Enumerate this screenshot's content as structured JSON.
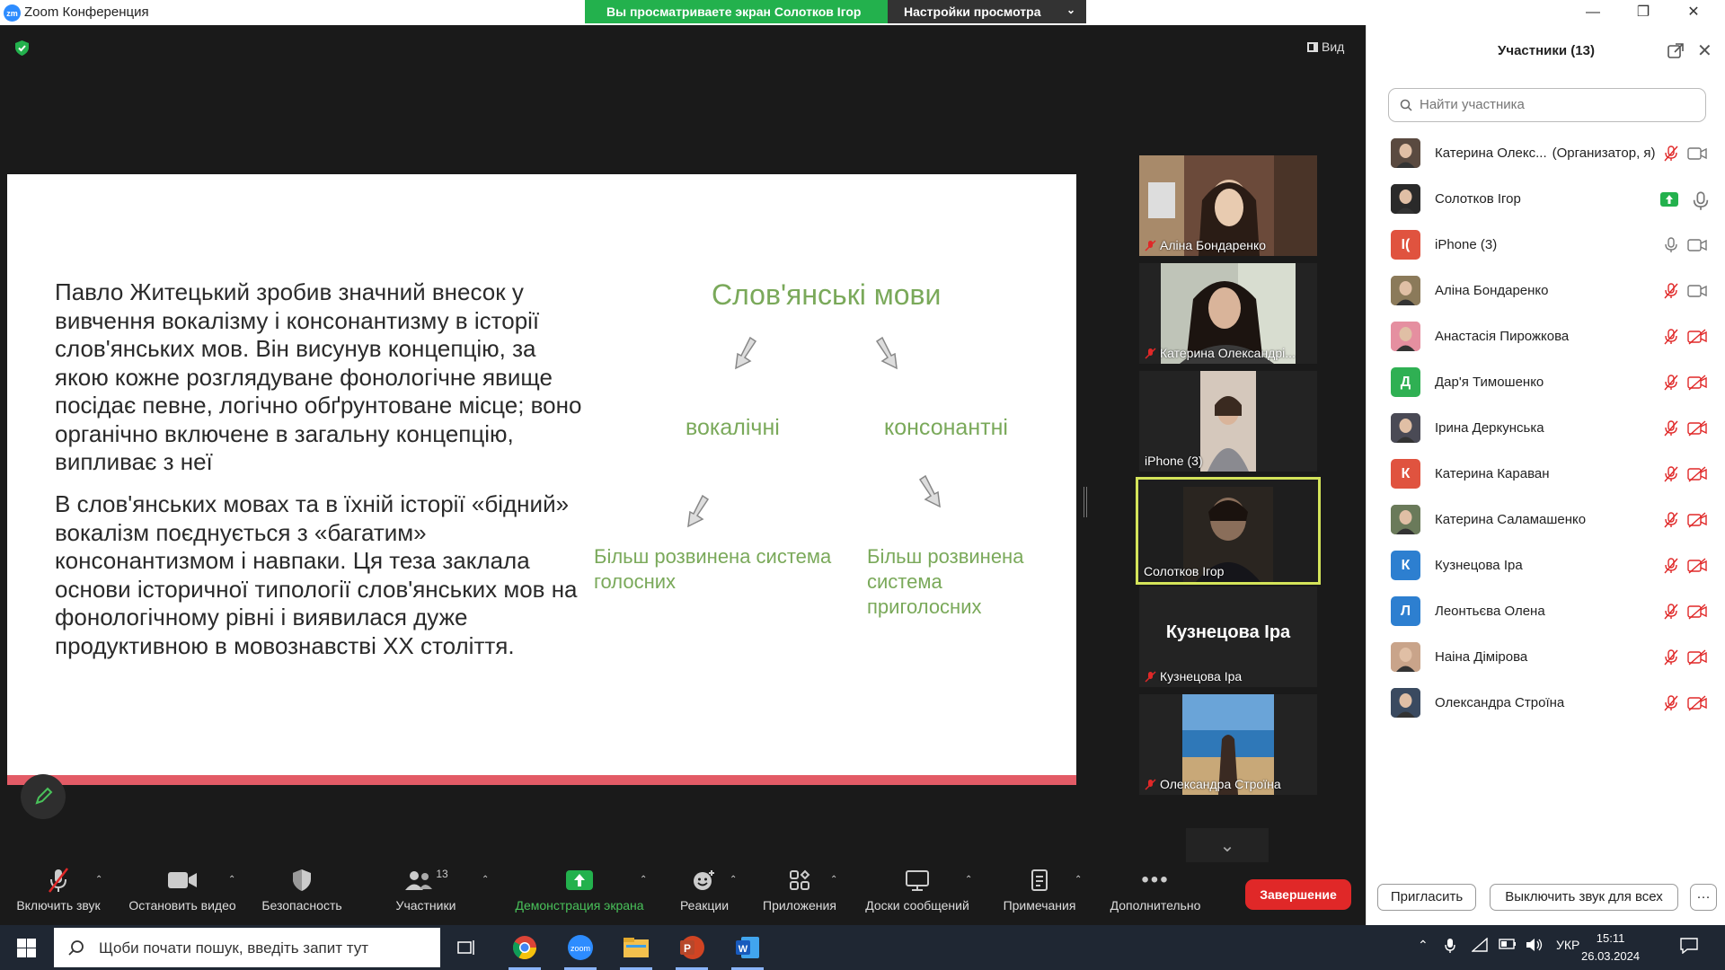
{
  "window": {
    "title": "Zoom Конференция",
    "app_icon_text": "zm",
    "share_banner": "Вы просматриваете экран Солотков Ігор",
    "view_settings": "Настройки просмотра"
  },
  "view_button": "Вид",
  "slide": {
    "paragraph1": "Павло Житецький зробив значний внесок у вивчення вокалізму і консонантизму в історії слов'янських мов. Він висунув концепцію, за якою кожне розглядуване фонологічне явище посідає певне, логічно обґрунтоване місце; воно органічно включене в загальну концепцію, випливає з неї",
    "paragraph2": "В слов'янських мовах та в їхній історії «бідний» вокалізм поєднується з «багатим» консонантизмом і навпаки. Ця теза заклала основи історичної типології слов'янських мов на фонологічному рівні і виявилася дуже продуктивною в мовознавстві XX століття.",
    "heading": "Слов'янські мови",
    "branch_left": "вокалічні",
    "branch_right": "консонантні",
    "sub_left": "Більш розвинена система голосних",
    "sub_right": "Більш розвинена система приголосних"
  },
  "tiles": [
    {
      "name": "Аліна Бондаренко",
      "muted": true
    },
    {
      "name": "Катерина Олександрі...",
      "muted": true
    },
    {
      "name": "iPhone (3)",
      "muted": false
    },
    {
      "name": "Солотков Ігор",
      "muted": false,
      "active": true
    },
    {
      "name": "Кузнецова Іра",
      "muted": true,
      "display_name": "Кузнецова Іра"
    },
    {
      "name": "Олександра Строїна",
      "muted": true
    }
  ],
  "toolbar": {
    "unmute": "Включить звук",
    "stop_video": "Остановить видео",
    "security": "Безопасность",
    "participants": "Участники",
    "participants_count": "13",
    "share_screen": "Демонстрация экрана",
    "reactions": "Реакции",
    "apps": "Приложения",
    "whiteboards": "Доски сообщений",
    "notes": "Примечания",
    "more": "Дополнительно",
    "end": "Завершение"
  },
  "panel": {
    "title": "Участники (13)",
    "search_placeholder": "Найти участника",
    "invite": "Пригласить",
    "mute_all": "Выключить звук для всех",
    "more": "···",
    "participants": [
      {
        "name": "Катерина Олекс...",
        "role": "(Организатор, я)",
        "avatar": "photo",
        "color": "#5a4a40",
        "mic": "muted",
        "video": "on"
      },
      {
        "name": "Солотков Ігор",
        "role": "",
        "avatar": "photo",
        "color": "#2a2a2a",
        "mic": "on",
        "video": "sharing"
      },
      {
        "name": "iPhone (3)",
        "role": "",
        "avatar": "I(",
        "color": "#e0533f",
        "mic": "on",
        "video": "on"
      },
      {
        "name": "Аліна Бондаренко",
        "role": "",
        "avatar": "photo",
        "color": "#8b7a5a",
        "mic": "muted",
        "video": "on"
      },
      {
        "name": "Анастасія Пирожкова",
        "role": "",
        "avatar": "photo",
        "color": "#e58fa0",
        "mic": "muted",
        "video": "off"
      },
      {
        "name": "Дар'я Тимошенко",
        "role": "",
        "avatar": "Д",
        "color": "#2fb053",
        "mic": "muted",
        "video": "off"
      },
      {
        "name": "Ірина Деркунська",
        "role": "",
        "avatar": "photo",
        "color": "#4a4a55",
        "mic": "muted",
        "video": "off"
      },
      {
        "name": "Катерина Караван",
        "role": "",
        "avatar": "К",
        "color": "#e0533f",
        "mic": "muted",
        "video": "off"
      },
      {
        "name": "Катерина Саламашенко",
        "role": "",
        "avatar": "photo",
        "color": "#6a7a5a",
        "mic": "muted",
        "video": "off"
      },
      {
        "name": "Кузнецова Іра",
        "role": "",
        "avatar": "К",
        "color": "#2d7fd0",
        "mic": "muted",
        "video": "off"
      },
      {
        "name": "Леонтьєва Олена",
        "role": "",
        "avatar": "Л",
        "color": "#2d7fd0",
        "mic": "muted",
        "video": "off"
      },
      {
        "name": "Наіна Дімірова",
        "role": "",
        "avatar": "photo",
        "color": "#c9a48a",
        "mic": "muted",
        "video": "off"
      },
      {
        "name": "Олександра Строїна",
        "role": "",
        "avatar": "photo",
        "color": "#3a4a60",
        "mic": "muted",
        "video": "off"
      }
    ]
  },
  "taskbar": {
    "search_text": "Щоби почати пошук, введіть запит тут",
    "lang": "УКР",
    "time": "15:11",
    "date": "26.03.2024"
  }
}
